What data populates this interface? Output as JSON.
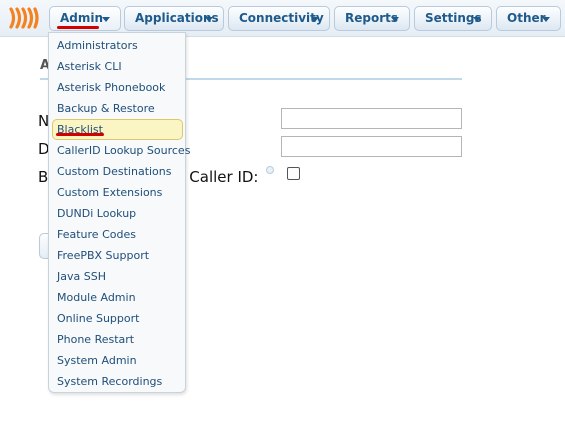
{
  "nav": {
    "items": [
      {
        "label": "Admin"
      },
      {
        "label": "Applications"
      },
      {
        "label": "Connectivity"
      },
      {
        "label": "Reports"
      },
      {
        "label": "Settings"
      },
      {
        "label": "Other"
      }
    ]
  },
  "background_form": {
    "section_title": "Ad",
    "label_1": "N",
    "label_2": "D",
    "label_3_start": "B",
    "label_3_end": "d Caller ID:"
  },
  "admin_menu": {
    "selected": "Blacklist",
    "items": [
      "Administrators",
      "Asterisk CLI",
      "Asterisk Phonebook",
      "Backup & Restore",
      "Blacklist",
      "CallerID Lookup Sources",
      "Custom Destinations",
      "Custom Extensions",
      "DUNDi Lookup",
      "Feature Codes",
      "FreePBX Support",
      "Java SSH",
      "Module Admin",
      "Online Support",
      "Phone Restart",
      "System Admin",
      "System Recordings"
    ]
  },
  "colors": {
    "brand": "#f58220",
    "nav_text": "#1f5a8c",
    "menu_text": "#1f4e79",
    "highlight": "#fbf5c4",
    "annotation": "#d40000"
  }
}
